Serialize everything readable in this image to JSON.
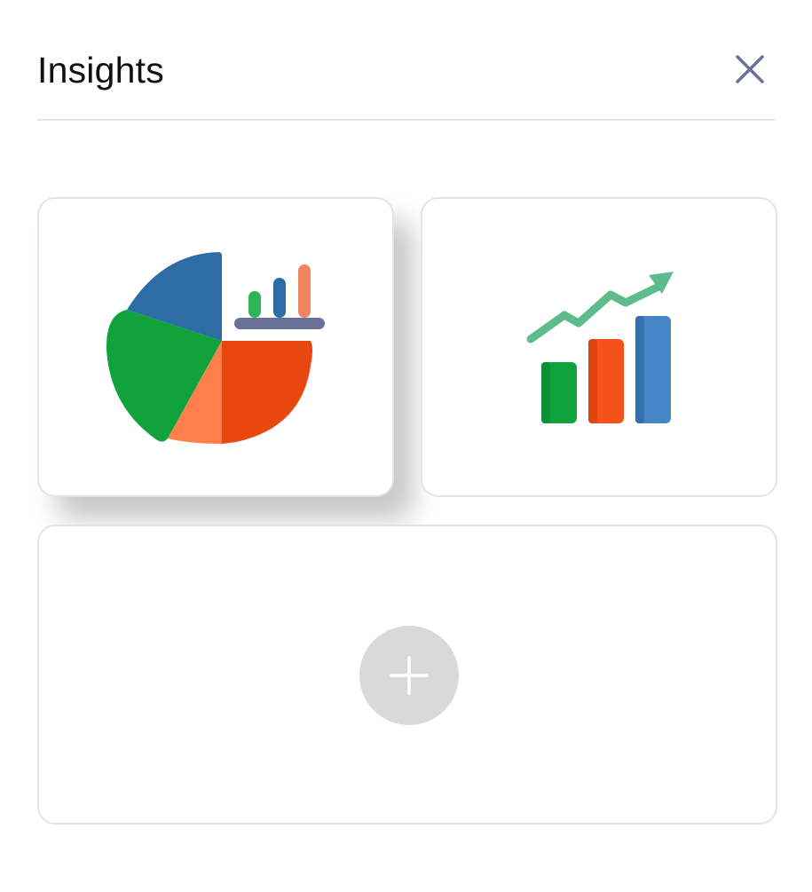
{
  "header": {
    "title": "Insights"
  },
  "icons": {
    "close": "close-icon",
    "pie_chart": "pie-chart-icon",
    "growth_chart": "growth-chart-icon",
    "add": "plus-icon"
  },
  "colors": {
    "blue": "#2d6ca4",
    "green": "#11a33b",
    "orange_red": "#e84810",
    "orange_light": "#ff7f4c",
    "slate": "#6a7196",
    "growth_line": "#5dbb8e",
    "bar_green": "#0fa33e",
    "bar_orange": "#f5521b",
    "bar_blue": "#4486c6",
    "add_circle": "#d9d9d9",
    "divider": "#e6e6e9"
  }
}
